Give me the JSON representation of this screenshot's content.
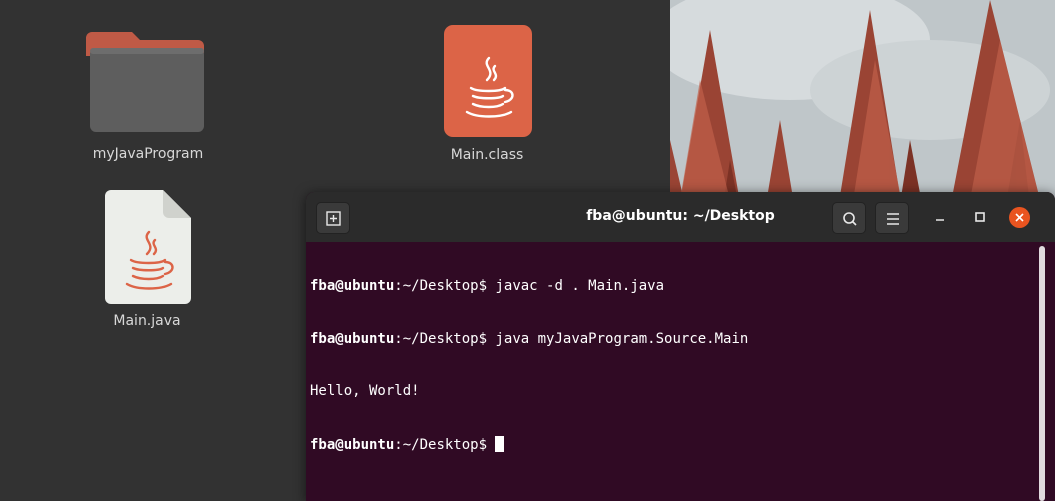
{
  "desktop": {
    "icons": [
      {
        "label": "myJavaProgram",
        "icon": "folder-icon"
      },
      {
        "label": "Main.class",
        "icon": "java-class-icon"
      },
      {
        "label": "Main.java",
        "icon": "java-file-icon"
      }
    ]
  },
  "terminal": {
    "title": "fba@ubuntu: ~/Desktop",
    "new_tab_icon": "new-tab-icon",
    "search_icon": "search-icon",
    "menu_icon": "hamburger-menu-icon",
    "lines": [
      {
        "user": "fba@ubuntu",
        "colon": ":",
        "path": "~/Desktop",
        "dollar": "$",
        "command": " javac -d . Main.java"
      },
      {
        "user": "fba@ubuntu",
        "colon": ":",
        "path": "~/Desktop",
        "dollar": "$",
        "command": " java myJavaProgram.Source.Main"
      },
      {
        "output": "Hello, World!"
      },
      {
        "user": "fba@ubuntu",
        "colon": ":",
        "path": "~/Desktop",
        "dollar": "$",
        "command": " "
      }
    ]
  },
  "colors": {
    "terminal_bg": "#300a24",
    "header_bg": "#2b2b2b",
    "close_button": "#e95420",
    "java_orange": "#dc6447"
  }
}
